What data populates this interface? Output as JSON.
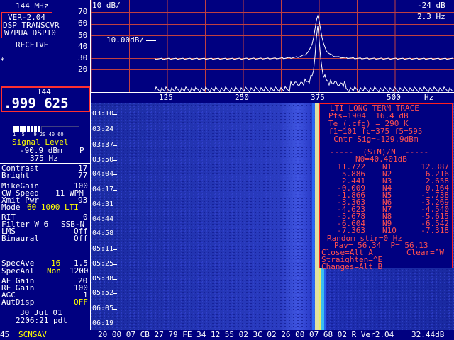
{
  "left_panel": {
    "band": "144 MHz",
    "version_box": [
      "VER-2.04",
      "DSP TRANSCVR",
      "W7PUA DSP10"
    ],
    "mode_status": "RECEIVE",
    "cursor_mark": "*",
    "freq_band": "144",
    "frequency": ".999 625",
    "meter_scale": "1  5   9 20 40 60",
    "signal_level_label": "Signal Level",
    "signal_dbm": "-90.9 dBm",
    "signal_p": "P",
    "signal_hz": "375 Hz",
    "params": [
      {
        "label": "Contrast",
        "value": "17"
      },
      {
        "label": "Bright",
        "value": "77"
      }
    ],
    "params2": [
      {
        "label": "MikeGain",
        "value": "100"
      },
      {
        "label": "CW Speed",
        "value": "11 WPM"
      },
      {
        "label": "Xmit Pwr",
        "value": "93"
      }
    ],
    "mode_line": {
      "label": "Mode",
      "value": "60 1000 LTI"
    },
    "params3": [
      {
        "label": "RIT",
        "value": "0"
      },
      {
        "label": "Filter W 6",
        "value": "SSB-N"
      },
      {
        "label": "LMS",
        "value": "Off"
      },
      {
        "label": "Binaural",
        "value": "Off"
      }
    ],
    "spec_ave": {
      "label": "SpecAve",
      "v1": "16",
      "v2": "1.5"
    },
    "spec_anl": {
      "label": "SpecAnl",
      "v1": "Non",
      "v2": "1200"
    },
    "gains": [
      {
        "label": "AF Gain",
        "value": "20"
      },
      {
        "label": "RF Gain",
        "value": "100"
      },
      {
        "label": "AGC",
        "value": "1"
      },
      {
        "label": "AutDisp",
        "value": "OFF"
      }
    ],
    "date": "30 Jul 01",
    "time": "2206:21 pdt"
  },
  "spectrum": {
    "top_left": "10 dB/",
    "top_right": "-24 dB",
    "hz_res": "2.3 Hz",
    "ref_label": "10.00dB/",
    "y_ticks": [
      "70",
      "60",
      "50",
      "40",
      "30",
      "20"
    ],
    "x_ticks": [
      "125",
      "250",
      "375",
      "500"
    ],
    "x_unit": "Hz"
  },
  "waterfall": {
    "times": [
      "03:10",
      "03:24",
      "03:37",
      "03:50",
      "04:04",
      "04:17",
      "04:31",
      "04:44",
      "04:58",
      "05:11",
      "05:25",
      "05:38",
      "05:52",
      "06:05",
      "06:19"
    ]
  },
  "lti": {
    "title": "LTI LONG TERM TRACE",
    "lines": [
      "Pts=1904  16.4 dB",
      "Te (.cfg) = 290 K",
      "f1=101 fc=375 f5=595",
      "  Cntr Sig=-129.9dBm"
    ],
    "sn_header": "-----  (S+N)/N  -----",
    "n0": "N0=40.401dB",
    "table": [
      [
        "11.722",
        "N1",
        "12.387"
      ],
      [
        "5.886",
        "N2",
        "6.216"
      ],
      [
        "2.441",
        "N3",
        "2.658"
      ],
      [
        "-0.009",
        "N4",
        "0.164"
      ],
      [
        "-1.866",
        "N5",
        "-1.738"
      ],
      [
        "-3.363",
        "N6",
        "-3.269"
      ],
      [
        "-4.623",
        "N7",
        "-4.540"
      ],
      [
        "-5.678",
        "N8",
        "-5.615"
      ],
      [
        "-6.604",
        "N9",
        "-6.542"
      ],
      [
        "-7.363",
        "N10",
        "-7.318"
      ]
    ],
    "random_stir": "Random stir=0 Hz",
    "pav": "Pav= 56.34  P= 56.13",
    "close": "Close=Alt A",
    "clear": "Clear=^W",
    "straighten": "Straighten=^E",
    "changes": "Changes=Alt B"
  },
  "status_bar": {
    "left_num": "45",
    "scnsav": "SCNSAV",
    "hex": "20 00 07 CB 27 79 FE 34 12 55 02 3C 02 26 00 07 68 02 R Ver2.04",
    "db": "32.44dB"
  },
  "colors": {
    "background": "#000080",
    "grid": "#c04040",
    "accent_red": "#ff3030",
    "label_yellow": "#ffff00",
    "text_white": "#ffffff"
  }
}
